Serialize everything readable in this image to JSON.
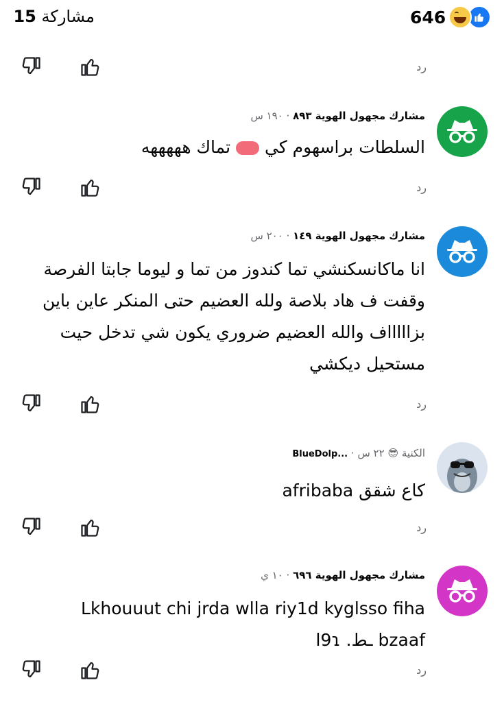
{
  "header": {
    "reactions_count": "646",
    "shares_count": "15",
    "shares_label": "مشاركة"
  },
  "reply_label": "رد",
  "colors": {
    "green": "#16a34a",
    "blue": "#1c8adb",
    "purple": "#d336c6",
    "like_blue": "#1877f2"
  },
  "comments": [
    {
      "name": "مشارك مجهول الهوية ٨٩٣",
      "time": "١٩٠ س",
      "text_before": "السلطات براسهوم كي",
      "text_after": "تماك هههههه",
      "avatar": "incognito-icon"
    },
    {
      "name": "مشارك مجهول الهوية ١٤٩",
      "time": "٢٠٠ س",
      "lines": [
        "انا ماكانسكنشي تما كندوز من تما و ليوما جابتا الفرصة",
        "وقفت ف هاد بلاصة ولله العضيم حتى المنكر عاين باين",
        "بزاااااف والله العضيم ضروري يكون شي تدخل حيت",
        "مستحيل ديكشي"
      ],
      "avatar": "incognito-icon"
    },
    {
      "name": "الكنية",
      "name_extra": "...BlueDolp",
      "time": "٢٢ س",
      "text": "كاع شقق afribaba",
      "avatar": "dolphin-sunglasses-avatar"
    },
    {
      "name": "مشارك مجهول الهوية ٦٩٦",
      "time": "١٠ ي",
      "lines": [
        "Lkhouuut chi jrda wlla riy1d kyglsso fiha",
        "l9ɿ .ـط bzaaf"
      ],
      "avatar": "incognito-icon"
    }
  ]
}
